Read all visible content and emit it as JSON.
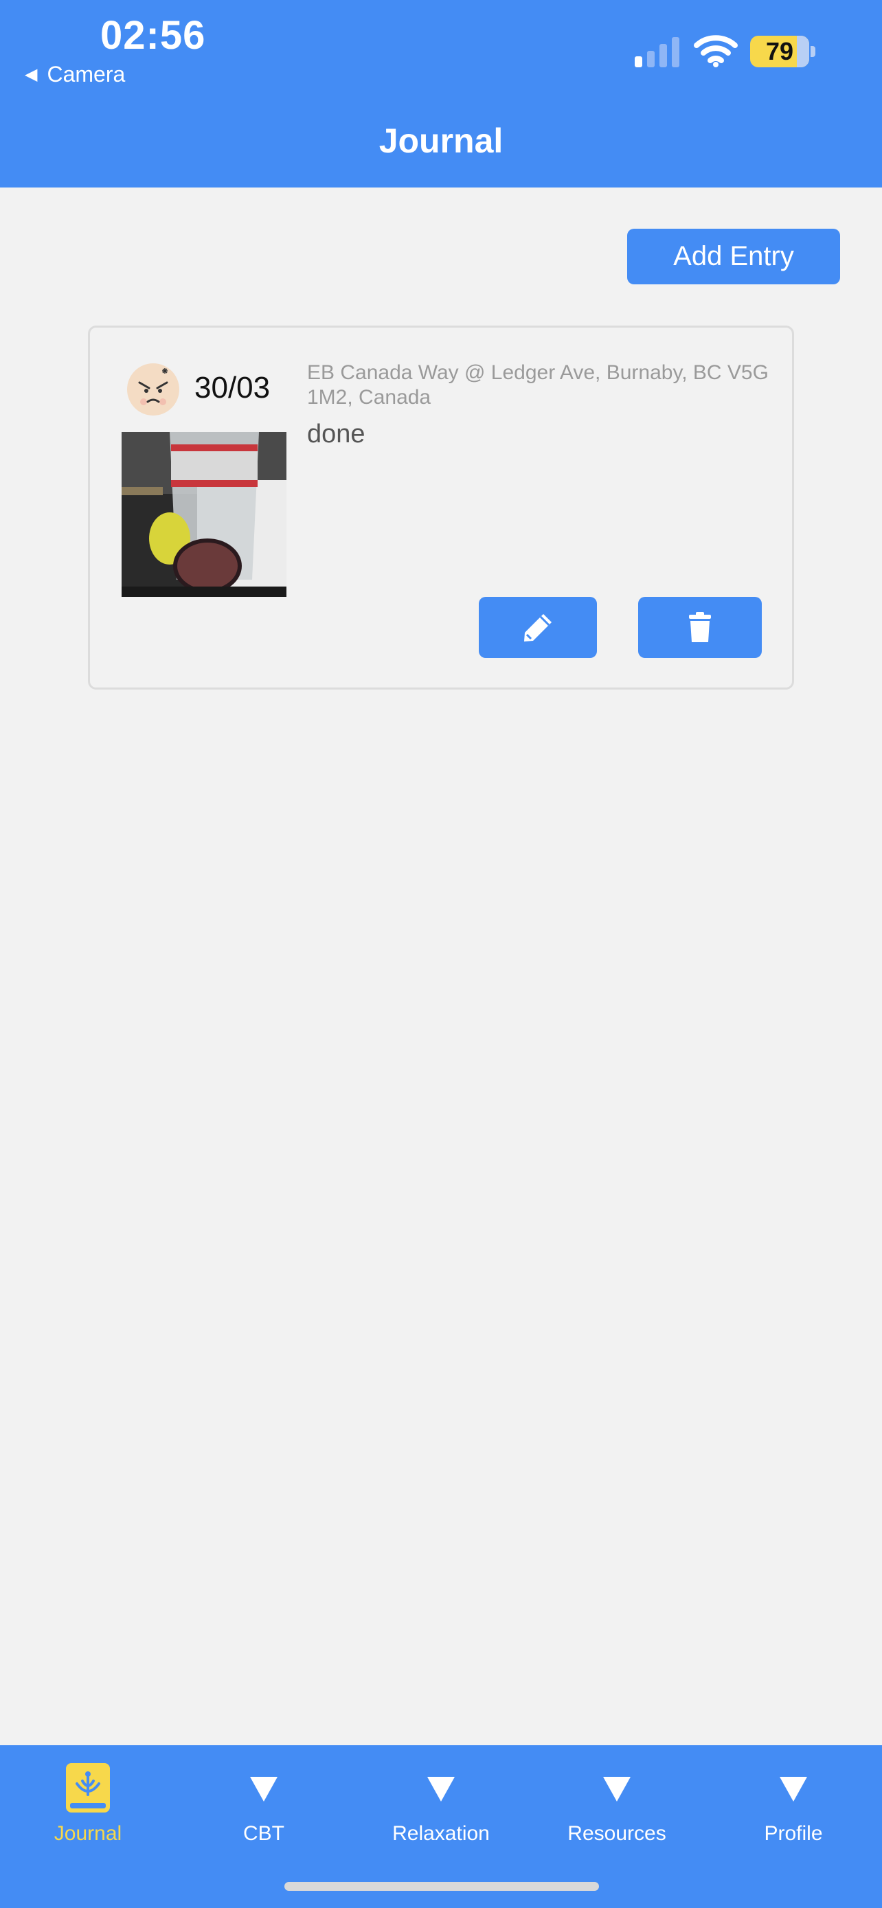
{
  "status_bar": {
    "time": "02:56",
    "back_app": "Camera",
    "battery": "79"
  },
  "header": {
    "title": "Journal"
  },
  "toolbar": {
    "add_entry_label": "Add Entry"
  },
  "entries": [
    {
      "date": "30/03",
      "location": "EB Canada Way @ Ledger Ave, Burnaby, BC V5G 1M2, Canada",
      "text": "done",
      "mood_icon": "angry-face-icon"
    }
  ],
  "tabs": [
    {
      "label": "Journal",
      "icon": "journal-icon",
      "active": true
    },
    {
      "label": "CBT",
      "icon": "triangle-down-icon",
      "active": false
    },
    {
      "label": "Relaxation",
      "icon": "triangle-down-icon",
      "active": false
    },
    {
      "label": "Resources",
      "icon": "triangle-down-icon",
      "active": false
    },
    {
      "label": "Profile",
      "icon": "triangle-down-icon",
      "active": false
    }
  ],
  "colors": {
    "primary": "#448cf4",
    "active_tab": "#f7d84b",
    "background": "#f2f2f2"
  }
}
